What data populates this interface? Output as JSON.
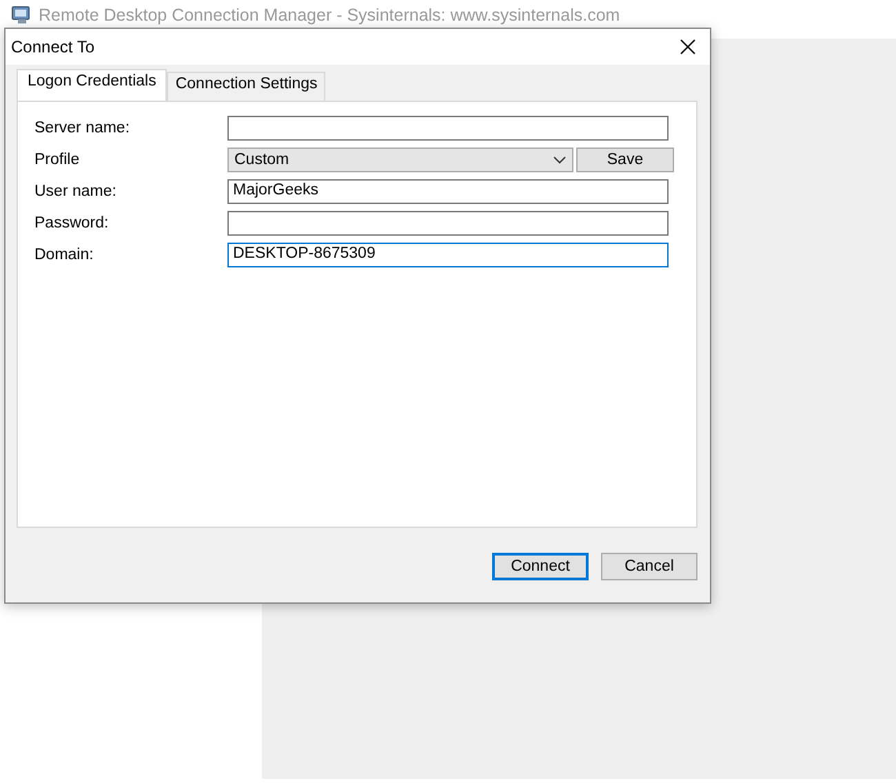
{
  "background_window": {
    "title": "Remote Desktop Connection Manager - Sysinternals: www.sysinternals.com"
  },
  "dialog": {
    "title": "Connect To",
    "tabs": [
      {
        "label": "Logon Credentials",
        "selected": true
      },
      {
        "label": "Connection Settings",
        "selected": false
      }
    ],
    "fields": [
      {
        "kind": "text",
        "label": "Server name:",
        "focused": false
      },
      {
        "kind": "dropdown",
        "label": "Profile",
        "value": "Custom",
        "button": "Save"
      },
      {
        "kind": "text",
        "label": "User name:",
        "value": "MajorGeeks",
        "focused": false
      },
      {
        "kind": "text",
        "label": "Password:",
        "focused": false
      },
      {
        "kind": "text",
        "label": "Domain:",
        "value": "DESKTOP-8675309",
        "focused": true
      }
    ],
    "buttons": [
      {
        "label": "Connect",
        "default": true
      },
      {
        "label": "Cancel",
        "default": false
      }
    ]
  }
}
